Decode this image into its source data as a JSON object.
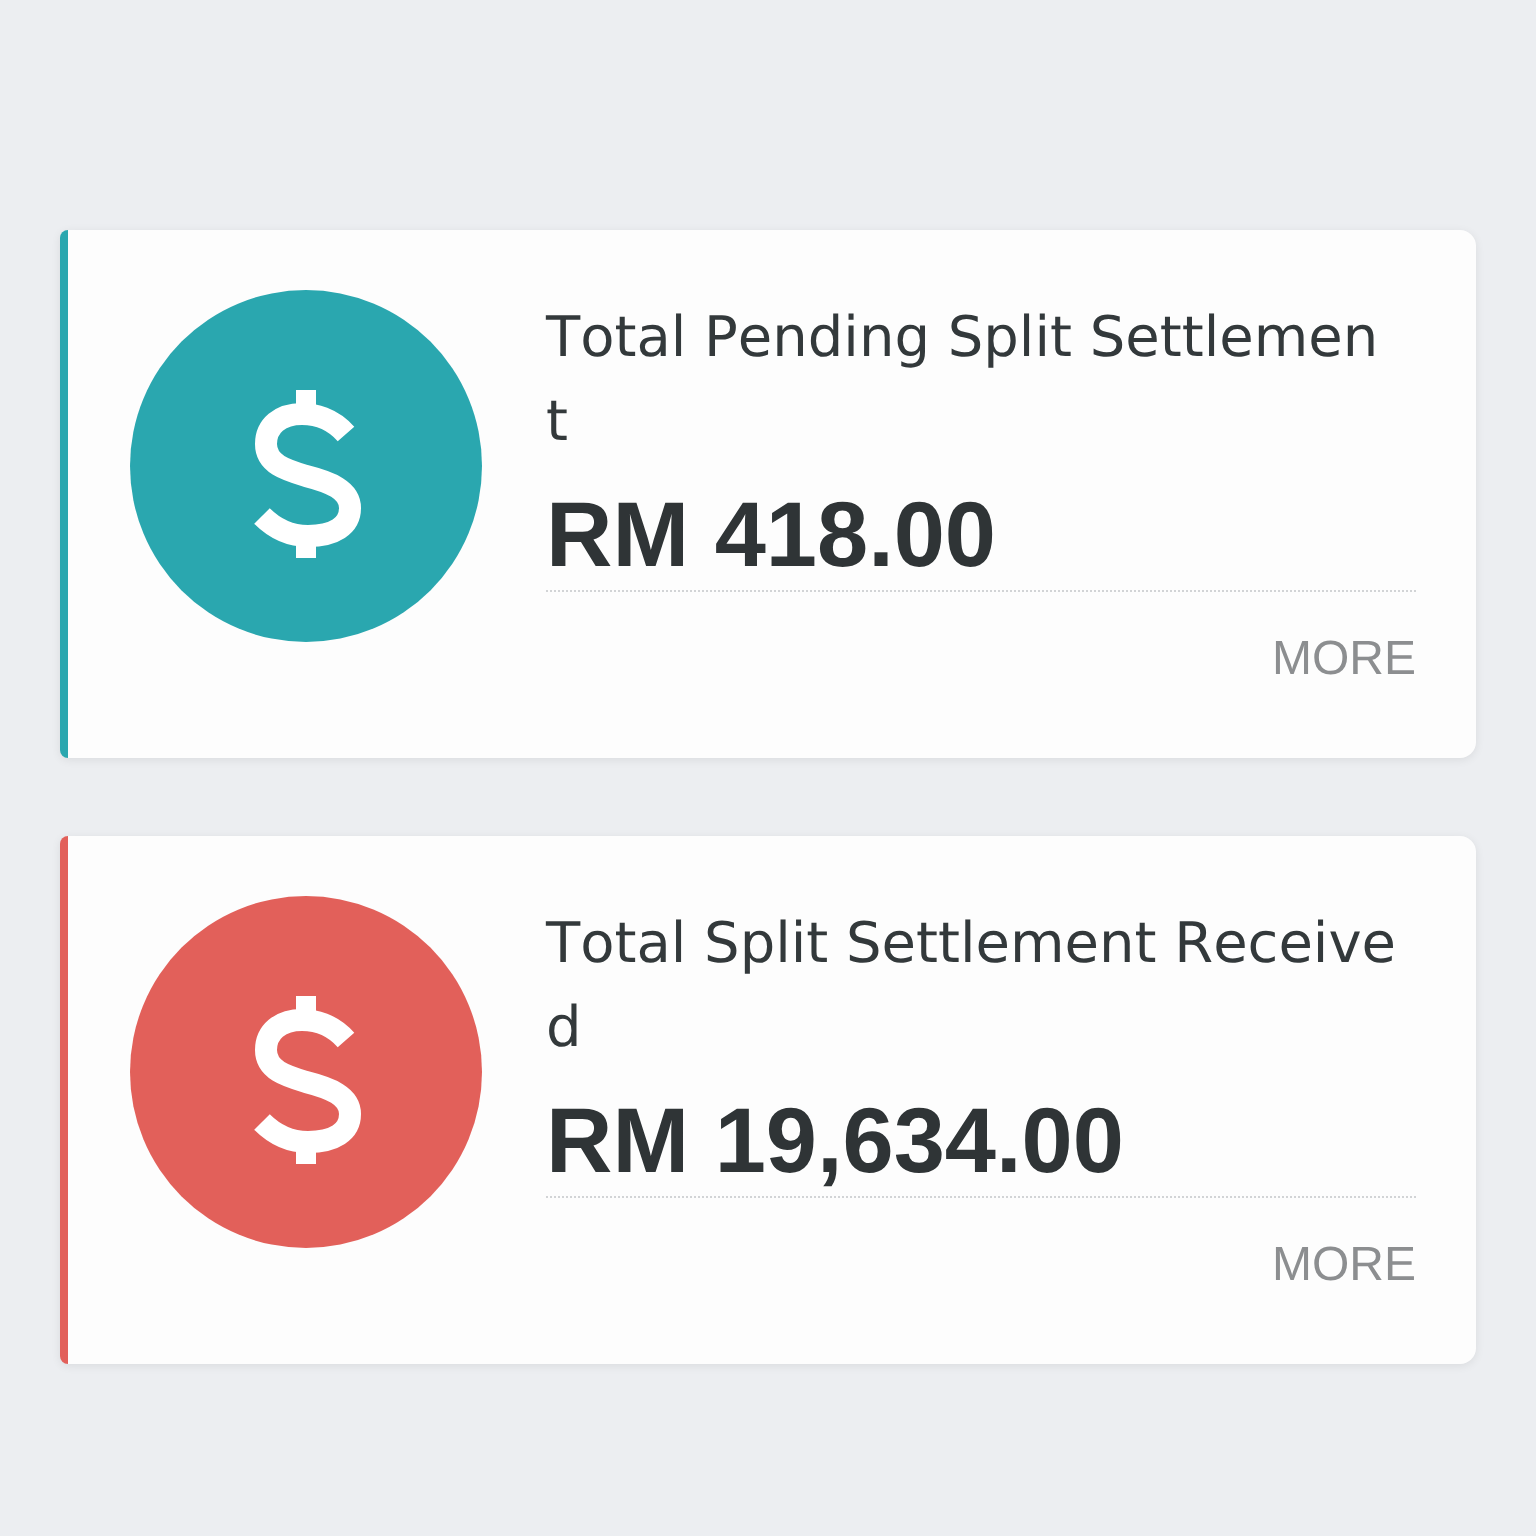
{
  "cards": [
    {
      "title": "Total Pending Split Settlement",
      "amount": "RM 418.00",
      "link": "MORE",
      "color": "#2aa7af"
    },
    {
      "title": "Total Split Settlement Received",
      "amount": "RM 19,634.00",
      "link": "MORE",
      "color": "#e2605a"
    }
  ]
}
